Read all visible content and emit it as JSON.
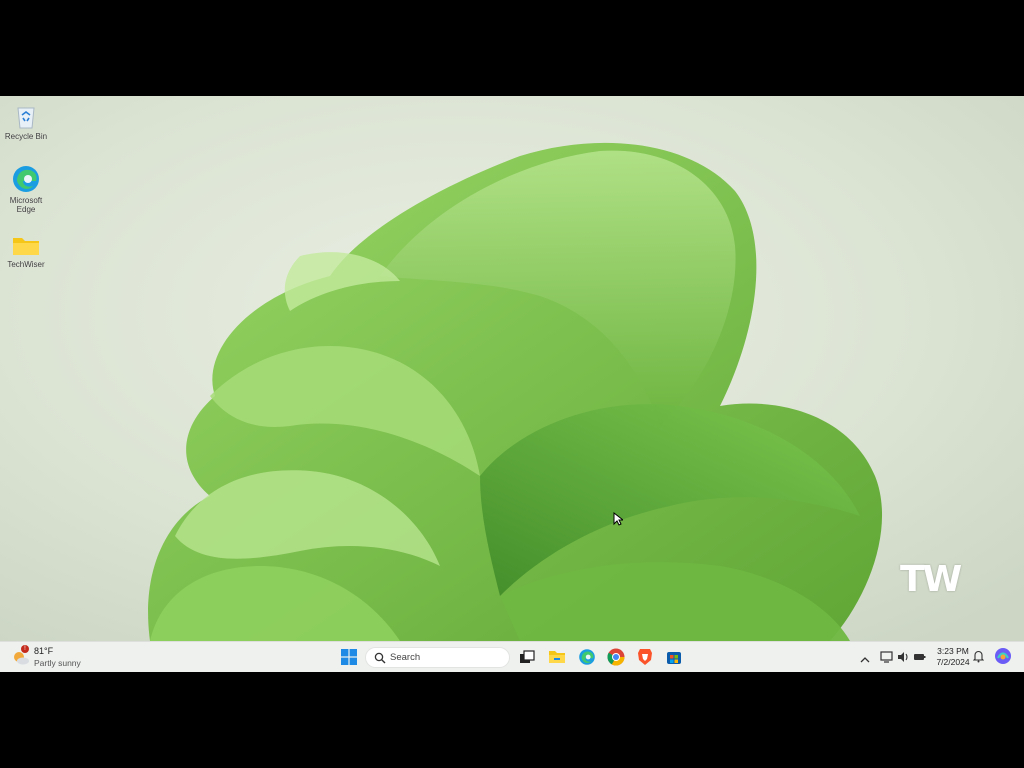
{
  "desktop": {
    "icons": [
      {
        "label": "Recycle Bin"
      },
      {
        "label": "Microsoft Edge"
      },
      {
        "label": "TechWiser"
      }
    ],
    "watermark": "TW"
  },
  "taskbar": {
    "weather": {
      "temperature": "81°F",
      "condition": "Partly sunny",
      "badge": "!"
    },
    "search": {
      "placeholder": "Search"
    },
    "apps": [
      "start-icon",
      "task-view-icon",
      "file-explorer-icon",
      "edge-icon",
      "chrome-icon",
      "brave-icon",
      "store-icon"
    ],
    "tray": {
      "time": "3:23 PM",
      "date": "7/2/2024"
    }
  },
  "colors": {
    "wallpaper_bg": "#dfe7d8",
    "bloom": "#7cc24a",
    "taskbar_bg": "#eef1ee"
  }
}
